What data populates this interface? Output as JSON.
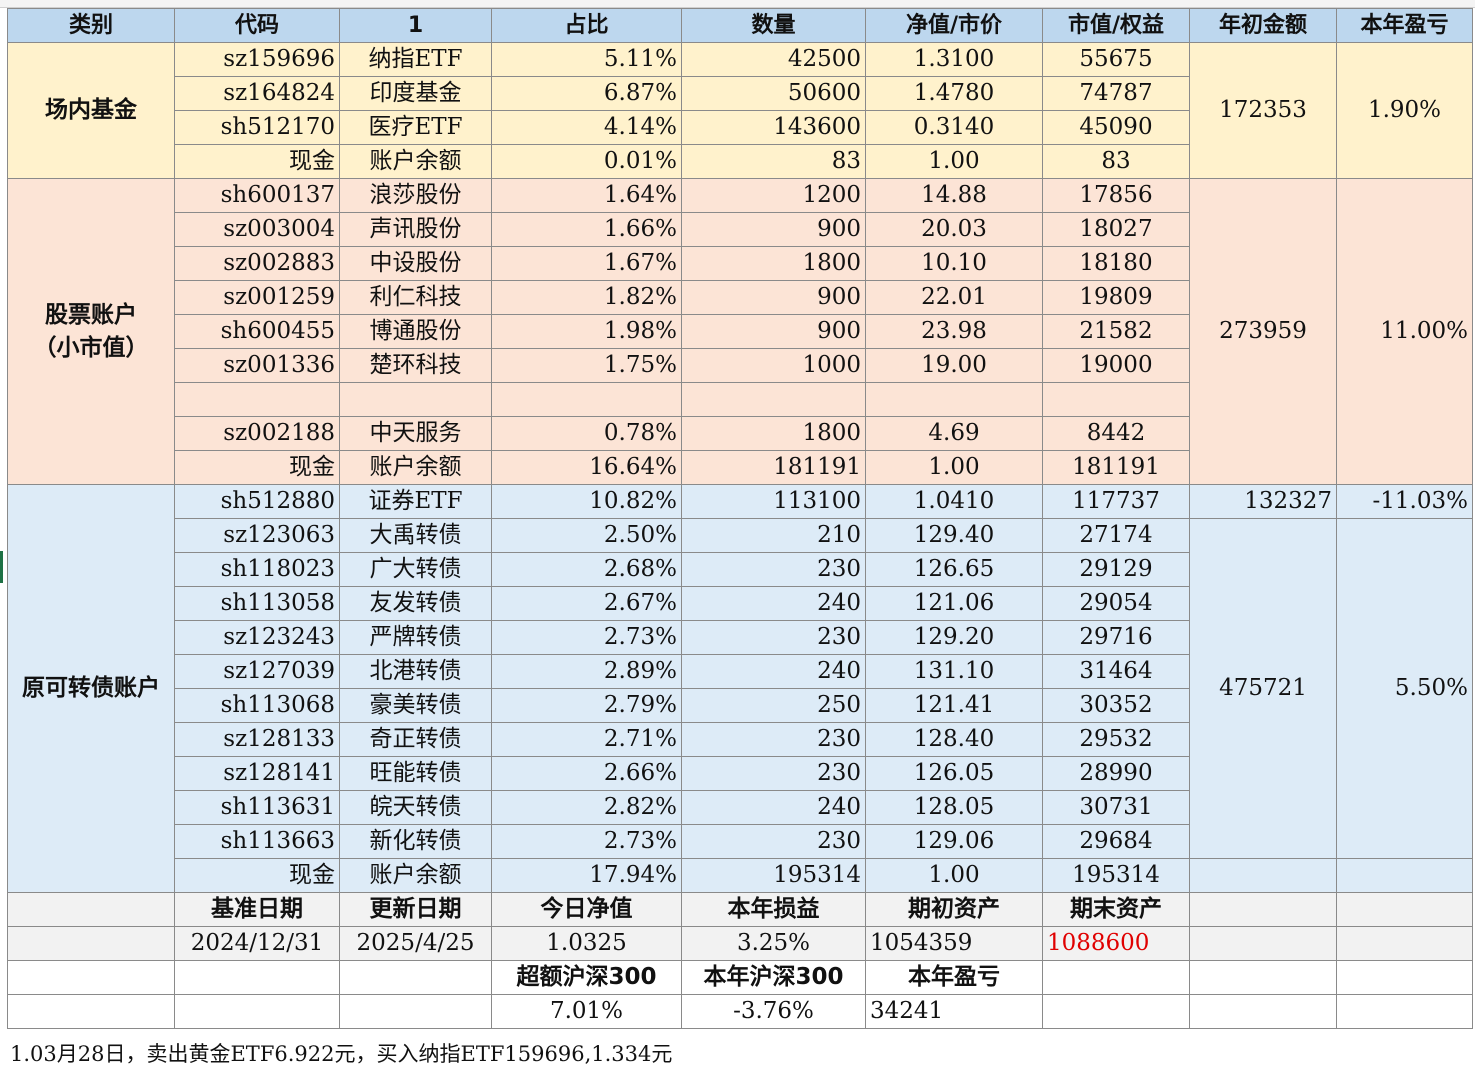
{
  "headers": [
    "类别",
    "代码",
    "1",
    "占比",
    "数量",
    "净值/市价",
    "市值/权益",
    "年初金额",
    "本年盈亏"
  ],
  "groups": {
    "fund": {
      "category": "场内基金",
      "start_amount": "172353",
      "pnl": "1.90%",
      "rows": [
        {
          "code": "sz159696",
          "name": "纳指ETF",
          "ratio": "5.11%",
          "qty": "42500",
          "price": "1.3100",
          "value": "55675"
        },
        {
          "code": "sz164824",
          "name": "印度基金",
          "ratio": "6.87%",
          "qty": "50600",
          "price": "1.4780",
          "value": "74787"
        },
        {
          "code": "sh512170",
          "name": "医疗ETF",
          "ratio": "4.14%",
          "qty": "143600",
          "price": "0.3140",
          "value": "45090"
        },
        {
          "code": "现金",
          "name": "账户余额",
          "ratio": "0.01%",
          "qty": "83",
          "price": "1.00",
          "value": "83"
        }
      ]
    },
    "stock": {
      "category_line1": "股票账户",
      "category_line2": "（小市值）",
      "start_amount": "273959",
      "pnl": "11.00%",
      "rows": [
        {
          "code": "sh600137",
          "name": "浪莎股份",
          "ratio": "1.64%",
          "qty": "1200",
          "price": "14.88",
          "value": "17856"
        },
        {
          "code": "sz003004",
          "name": "声讯股份",
          "ratio": "1.66%",
          "qty": "900",
          "price": "20.03",
          "value": "18027"
        },
        {
          "code": "sz002883",
          "name": "中设股份",
          "ratio": "1.67%",
          "qty": "1800",
          "price": "10.10",
          "value": "18180"
        },
        {
          "code": "sz001259",
          "name": "利仁科技",
          "ratio": "1.82%",
          "qty": "900",
          "price": "22.01",
          "value": "19809"
        },
        {
          "code": "sh600455",
          "name": "博通股份",
          "ratio": "1.98%",
          "qty": "900",
          "price": "23.98",
          "value": "21582"
        },
        {
          "code": "sz001336",
          "name": "楚环科技",
          "ratio": "1.75%",
          "qty": "1000",
          "price": "19.00",
          "value": "19000"
        },
        {
          "code": "",
          "name": "",
          "ratio": "",
          "qty": "",
          "price": "",
          "value": ""
        },
        {
          "code": "sz002188",
          "name": "中天服务",
          "ratio": "0.78%",
          "qty": "1800",
          "price": "4.69",
          "value": "8442"
        },
        {
          "code": "现金",
          "name": "账户余额",
          "ratio": "16.64%",
          "qty": "181191",
          "price": "1.00",
          "value": "181191"
        }
      ]
    },
    "cb": {
      "category": "原可转债账户",
      "etf_start_amount": "132327",
      "etf_pnl": "-11.03%",
      "start_amount": "475721",
      "pnl": "5.50%",
      "rows": [
        {
          "code": "sh512880",
          "name": "证券ETF",
          "ratio": "10.82%",
          "qty": "113100",
          "price": "1.0410",
          "value": "117737"
        },
        {
          "code": "sz123063",
          "name": "大禹转债",
          "ratio": "2.50%",
          "qty": "210",
          "price": "129.40",
          "value": "27174"
        },
        {
          "code": "sh118023",
          "name": "广大转债",
          "ratio": "2.68%",
          "qty": "230",
          "price": "126.65",
          "value": "29129"
        },
        {
          "code": "sh113058",
          "name": "友发转债",
          "ratio": "2.67%",
          "qty": "240",
          "price": "121.06",
          "value": "29054"
        },
        {
          "code": "sz123243",
          "name": "严牌转债",
          "ratio": "2.73%",
          "qty": "230",
          "price": "129.20",
          "value": "29716"
        },
        {
          "code": "sz127039",
          "name": "北港转债",
          "ratio": "2.89%",
          "qty": "240",
          "price": "131.10",
          "value": "31464"
        },
        {
          "code": "sh113068",
          "name": "豪美转债",
          "ratio": "2.79%",
          "qty": "250",
          "price": "121.41",
          "value": "30352"
        },
        {
          "code": "sz128133",
          "name": "奇正转债",
          "ratio": "2.71%",
          "qty": "230",
          "price": "128.40",
          "value": "29532"
        },
        {
          "code": "sz128141",
          "name": "旺能转债",
          "ratio": "2.66%",
          "qty": "230",
          "price": "126.05",
          "value": "28990"
        },
        {
          "code": "sh113631",
          "name": "皖天转债",
          "ratio": "2.82%",
          "qty": "240",
          "price": "128.05",
          "value": "30731"
        },
        {
          "code": "sh113663",
          "name": "新化转债",
          "ratio": "2.73%",
          "qty": "230",
          "price": "129.06",
          "value": "29684"
        },
        {
          "code": "现金",
          "name": "账户余额",
          "ratio": "17.94%",
          "qty": "195314",
          "price": "1.00",
          "value": "195314"
        }
      ]
    }
  },
  "summary": {
    "headers1": [
      "基准日期",
      "更新日期",
      "今日净值",
      "本年损益",
      "期初资产",
      "期末资产"
    ],
    "values1": [
      "2024/12/31",
      "2025/4/25",
      "1.0325",
      "3.25%",
      "1054359",
      "1088600"
    ],
    "headers2": [
      "超额沪深300",
      "本年沪深300",
      "本年盈亏"
    ],
    "values2": [
      "7.01%",
      "-3.76%",
      "34241"
    ]
  },
  "note": "1.03月28日，卖出黄金ETF6.922元，买入纳指ETF159696,1.334元",
  "colors": {
    "header_bg": "#bdd7ee",
    "fund_bg": "#fff2cc",
    "stock_bg": "#fce4d6",
    "cb_bg": "#ddebf7",
    "summary_bg": "#f2f2f2",
    "highlight_red": "#e00000"
  }
}
